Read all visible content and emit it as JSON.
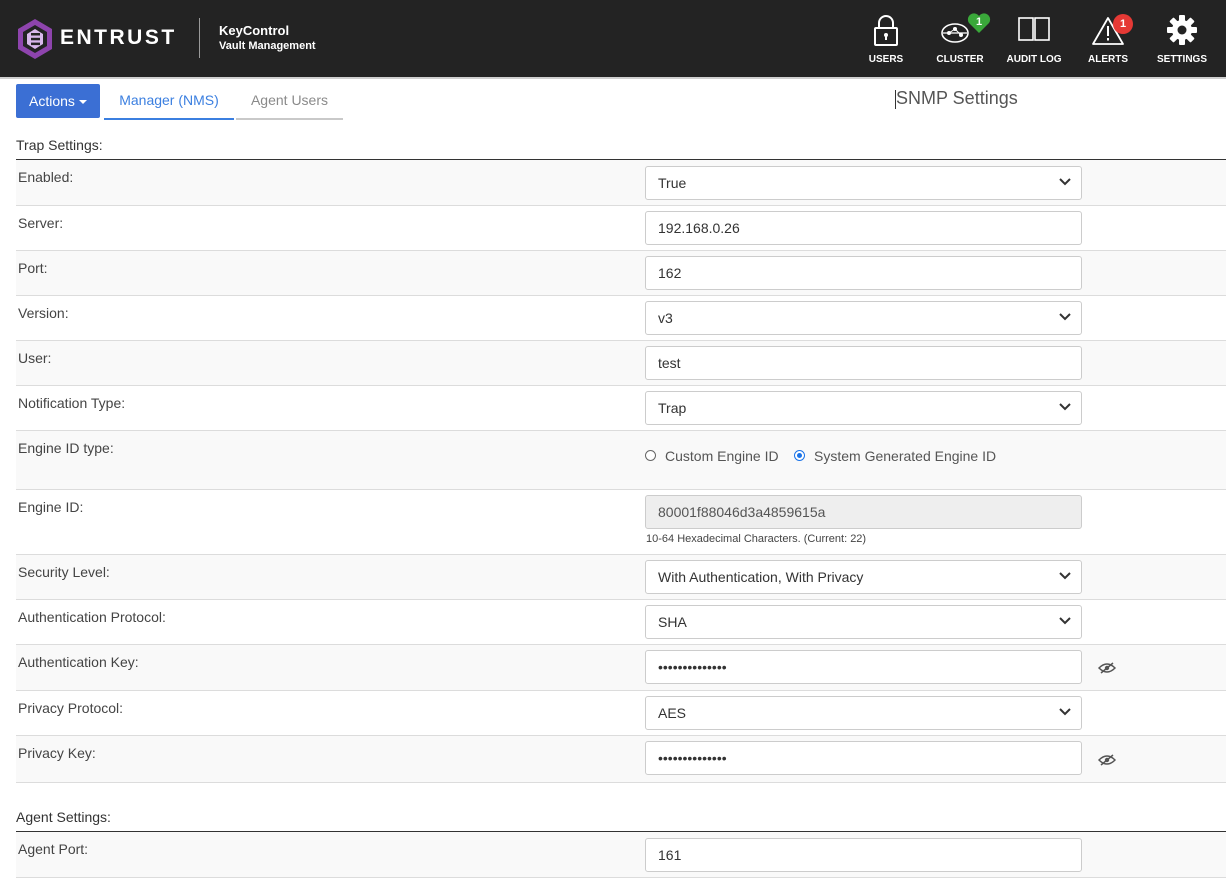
{
  "header": {
    "brand": "ENTRUST",
    "product_line1": "KeyControl",
    "product_line2": "Vault Management",
    "nav": [
      {
        "label": "USERS",
        "icon": "lock-icon"
      },
      {
        "label": "CLUSTER",
        "icon": "cluster-icon",
        "badge": "1",
        "badge_color": "#3aa83a"
      },
      {
        "label": "AUDIT LOG",
        "icon": "book-icon"
      },
      {
        "label": "ALERTS",
        "icon": "warning-icon",
        "badge": "1",
        "badge_color": "#e53935"
      },
      {
        "label": "SETTINGS",
        "icon": "gear-icon"
      }
    ]
  },
  "toolbar": {
    "actions_label": "Actions",
    "tabs": [
      {
        "label": "Manager (NMS)",
        "active": true
      },
      {
        "label": "Agent Users",
        "active": false
      }
    ],
    "page_title": "SNMP Settings"
  },
  "trap": {
    "title": "Trap Settings:",
    "enabled": {
      "label": "Enabled:",
      "value": "True"
    },
    "server": {
      "label": "Server:",
      "value": "192.168.0.26"
    },
    "port": {
      "label": "Port:",
      "value": "162"
    },
    "version": {
      "label": "Version:",
      "value": "v3"
    },
    "user": {
      "label": "User:",
      "value": "test"
    },
    "notification": {
      "label": "Notification Type:",
      "value": "Trap"
    },
    "engine_type": {
      "label": "Engine ID type:",
      "options": [
        "Custom Engine ID",
        "System Generated Engine ID"
      ],
      "selected": "System Generated Engine ID"
    },
    "engine_id": {
      "label": "Engine ID:",
      "value": "80001f88046d3a4859615a",
      "hint": "10-64 Hexadecimal Characters. (Current: 22)"
    },
    "security": {
      "label": "Security Level:",
      "value": "With Authentication, With Privacy"
    },
    "auth_protocol": {
      "label": "Authentication Protocol:",
      "value": "SHA"
    },
    "auth_key": {
      "label": "Authentication Key:",
      "value": "••••••••••••••"
    },
    "priv_protocol": {
      "label": "Privacy Protocol:",
      "value": "AES"
    },
    "priv_key": {
      "label": "Privacy Key:",
      "value": "••••••••••••••"
    }
  },
  "agent": {
    "title": "Agent Settings:",
    "port": {
      "label": "Agent Port:",
      "value": "161"
    }
  },
  "colors": {
    "accent": "#3b7fe0",
    "actions_button": "#3b6fd4",
    "topbar": "#232323",
    "logo": "#8e44ad"
  }
}
